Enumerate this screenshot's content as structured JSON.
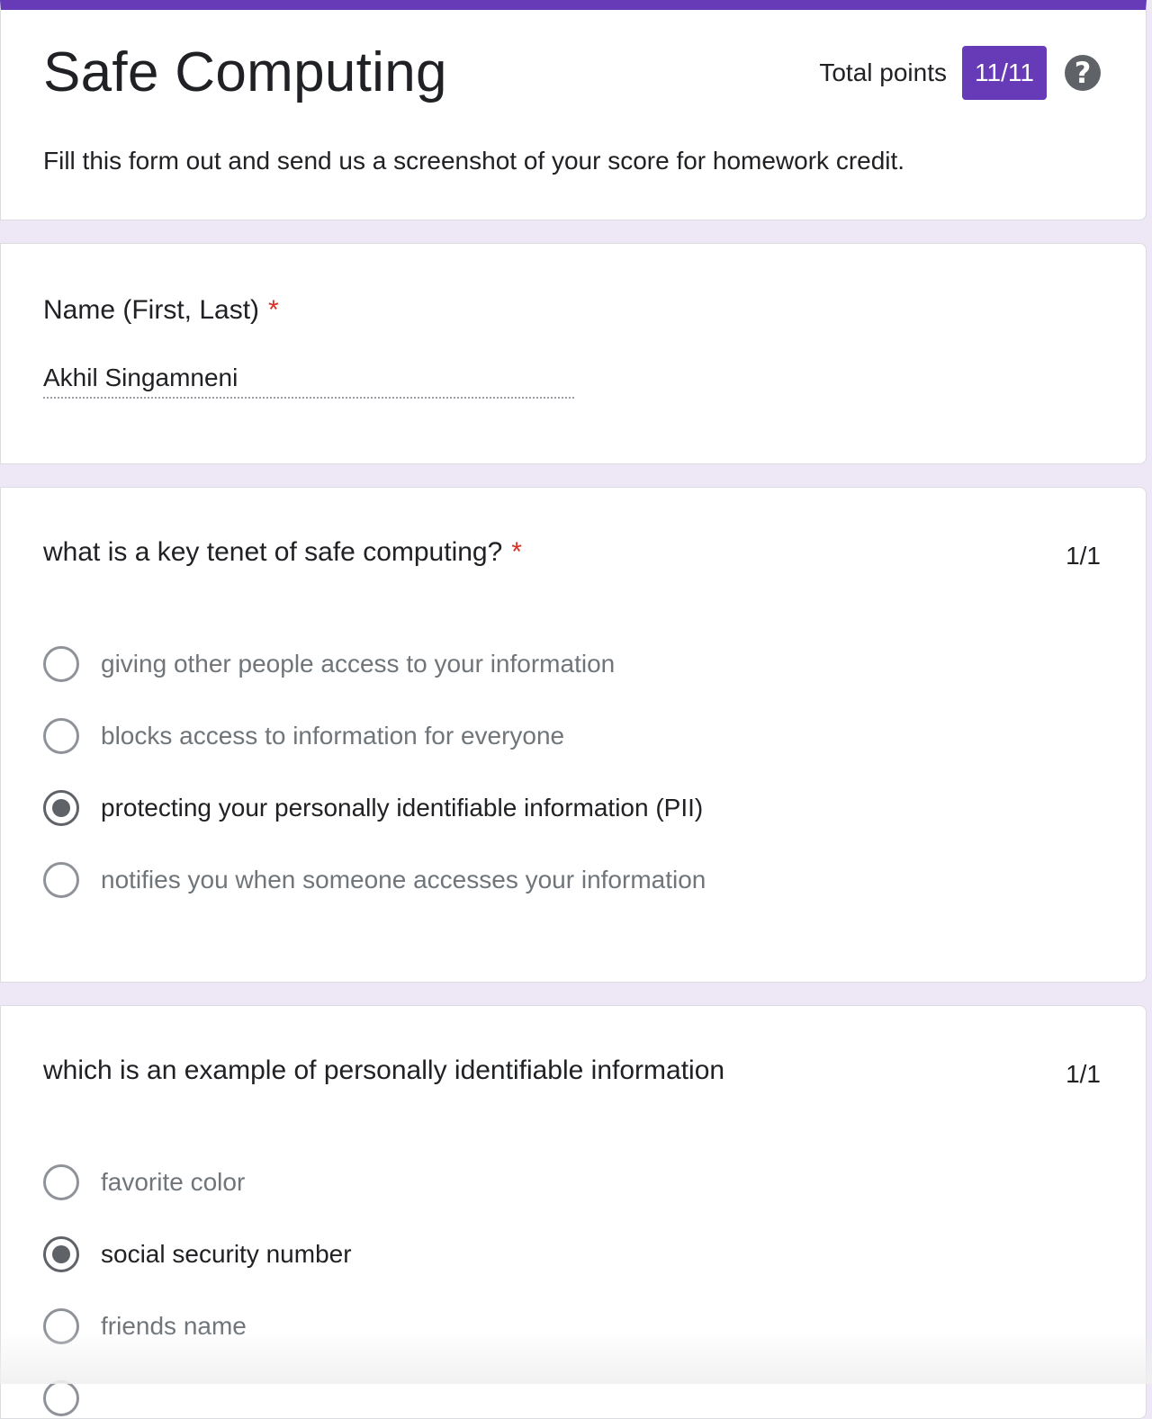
{
  "form": {
    "title": "Safe Computing",
    "description": "Fill this form out and send us a screenshot of your score for homework credit.",
    "points_label": "Total points",
    "points_value": "11/11",
    "help_icon": "help-question-icon",
    "accent_color": "#673ab7",
    "required_marker": "*"
  },
  "name_question": {
    "title": "Name (First, Last)",
    "required_marker": "*",
    "answer": "Akhil Singamneni"
  },
  "questions": [
    {
      "title": "what is a key tenet of safe computing?",
      "required_marker": "*",
      "score": "1/1",
      "options": [
        {
          "label": "giving other people access to your information",
          "selected": false
        },
        {
          "label": "blocks access to information for everyone",
          "selected": false
        },
        {
          "label": "protecting your personally identifiable information (PII)",
          "selected": true
        },
        {
          "label": "notifies you when someone accesses your information",
          "selected": false
        }
      ]
    },
    {
      "title": "which is an example of personally identifiable information",
      "score": "1/1",
      "options": [
        {
          "label": "favorite color",
          "selected": false
        },
        {
          "label": "social security number",
          "selected": true
        },
        {
          "label": "friends name",
          "selected": false
        }
      ]
    }
  ]
}
